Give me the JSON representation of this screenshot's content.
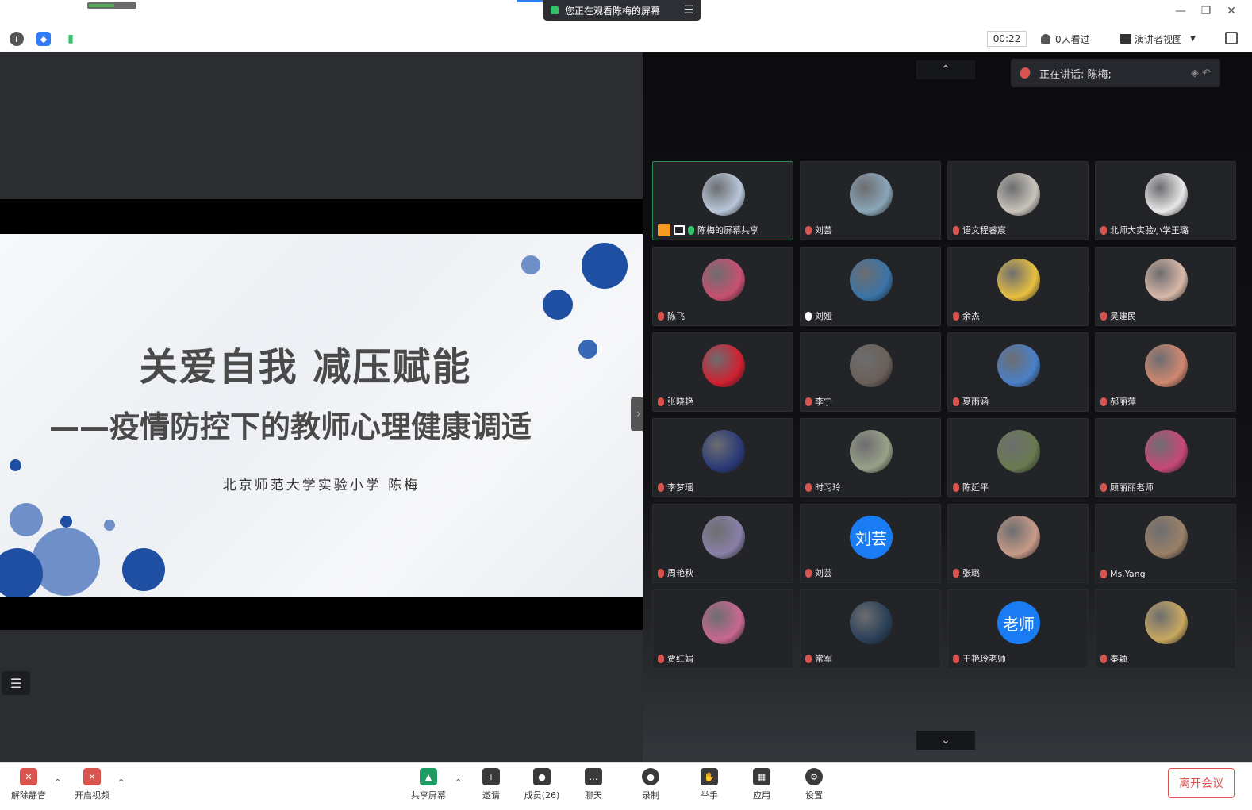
{
  "window": {
    "share_banner": "您正在观看陈梅的屏幕",
    "banner_menu_icon": "menu-icon",
    "controls": {
      "minimize": "—",
      "restore": "❐",
      "close": "✕"
    }
  },
  "toolbar": {
    "timer": "00:22",
    "viewers": "0人看过",
    "view_mode": "演讲者视图",
    "icons": [
      "info-icon",
      "shield-icon",
      "signal-icon"
    ]
  },
  "slide": {
    "title": "关爱自我  减压赋能",
    "subtitle": "——疫情防控下的教师心理健康调适",
    "author": "北京师范大学实验小学   陈梅"
  },
  "speaker": {
    "label": "正在讲话: 陈梅;"
  },
  "colors": {
    "accent": "#1a7cf2",
    "slide_dark_blue": "#1e4fa3",
    "slide_light_blue": "#6f8fc8",
    "leave": "#d9534f"
  },
  "participants": [
    {
      "name": "陈梅的屏幕共享",
      "avatar": "#b9c7da",
      "mic": "green",
      "sharing": true
    },
    {
      "name": "刘芸",
      "avatar": "#8aa5b8",
      "mic": "muted"
    },
    {
      "name": "语文程睿宸",
      "avatar": "#c9c4bb",
      "mic": "muted"
    },
    {
      "name": "北师大实验小学王璐",
      "avatar": "#e8e8e8",
      "mic": "muted"
    },
    {
      "name": "陈飞",
      "avatar": "#c85070",
      "mic": "muted"
    },
    {
      "name": "刘娅",
      "avatar": "#3a74a8",
      "mic": "on"
    },
    {
      "name": "余杰",
      "avatar": "#e8c040",
      "mic": "muted"
    },
    {
      "name": "吴建民",
      "avatar": "#d8b8a8",
      "mic": "muted"
    },
    {
      "name": "张晓艳",
      "avatar": "#d02030",
      "mic": "muted"
    },
    {
      "name": "李宁",
      "avatar": "#6a6058",
      "mic": "muted"
    },
    {
      "name": "夏雨涵",
      "avatar": "#4a80c8",
      "mic": "muted"
    },
    {
      "name": "郝丽萍",
      "avatar": "#d08870",
      "mic": "muted"
    },
    {
      "name": "李梦瑶",
      "avatar": "#2a3a78",
      "mic": "muted"
    },
    {
      "name": "时习玲",
      "avatar": "#9aa088",
      "mic": "muted"
    },
    {
      "name": "陈延平",
      "avatar": "#6a7a50",
      "mic": "muted"
    },
    {
      "name": "顾丽丽老师",
      "avatar": "#c84878",
      "mic": "muted"
    },
    {
      "name": "周艳秋",
      "avatar": "#8a80a8",
      "mic": "muted"
    },
    {
      "name": "刘芸",
      "avatar_text": "刘芸",
      "mic": "muted"
    },
    {
      "name": "张璐",
      "avatar": "#c89a88",
      "mic": "muted"
    },
    {
      "name": "Ms.Yang",
      "avatar": "#9a8068",
      "mic": "muted"
    },
    {
      "name": "贾红娟",
      "avatar": "#c86890",
      "mic": "muted"
    },
    {
      "name": "常军",
      "avatar": "#2a4058",
      "mic": "muted"
    },
    {
      "name": "王艳玲老师",
      "avatar_text": "老师",
      "mic": "muted"
    },
    {
      "name": "秦颖",
      "avatar": "#c8a860",
      "mic": "muted"
    }
  ],
  "bottom": {
    "unmute": "解除静音",
    "video": "开启视频",
    "share": "共享屏幕",
    "invite": "邀请",
    "members": "成员(26)",
    "chat": "聊天",
    "record": "录制",
    "raise_hand": "举手",
    "apps": "应用",
    "settings": "设置",
    "leave": "离开会议"
  }
}
